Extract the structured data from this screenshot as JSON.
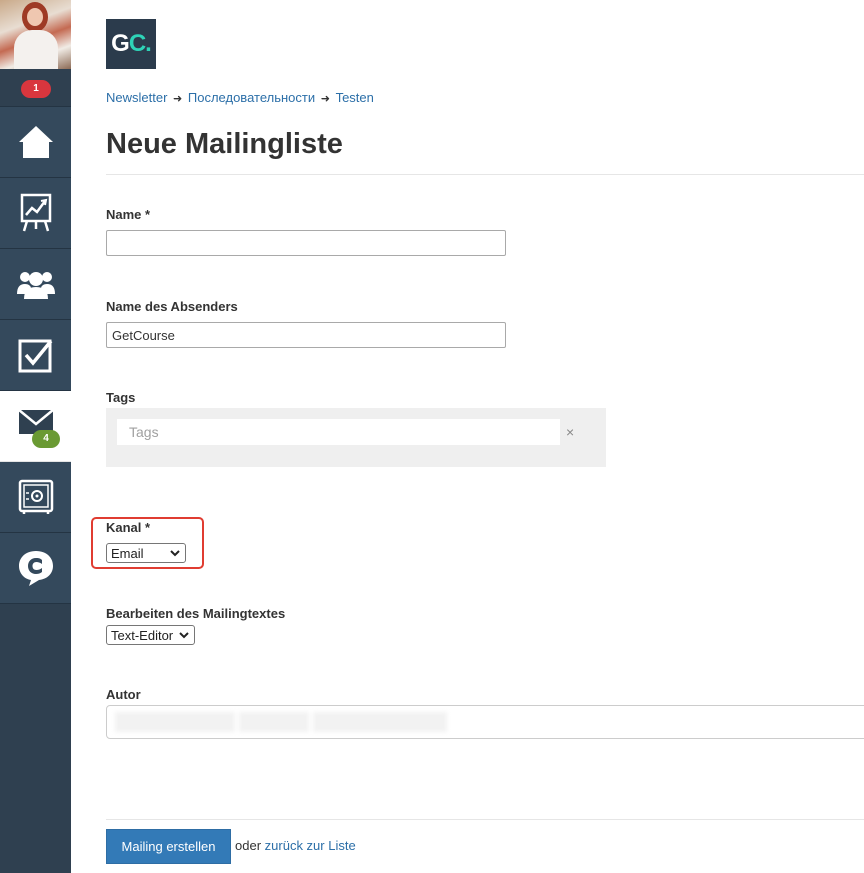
{
  "sidebar": {
    "notification_count": "1",
    "items": [
      {
        "icon": "home-icon"
      },
      {
        "icon": "chart-board-icon"
      },
      {
        "icon": "users-icon"
      },
      {
        "icon": "checkbox-icon"
      },
      {
        "icon": "mail-icon",
        "badge": "4",
        "active": true
      },
      {
        "icon": "safe-icon"
      },
      {
        "icon": "chat-logo-icon"
      }
    ]
  },
  "logo": {
    "text_main": "G",
    "text_accent": "C."
  },
  "breadcrumb": {
    "items": [
      "Newsletter",
      "Последовательности",
      "Testen"
    ],
    "separator": "➜"
  },
  "page": {
    "title": "Neue Mailingliste"
  },
  "form": {
    "name": {
      "label": "Name *",
      "value": ""
    },
    "sender": {
      "label": "Name des Absenders",
      "value": "GetCourse"
    },
    "tags": {
      "label": "Tags",
      "placeholder": "Tags",
      "clear": "×"
    },
    "channel": {
      "label": "Kanal *",
      "selected": "Email"
    },
    "editor": {
      "label": "Bearbeiten des Mailingtextes",
      "selected": "Text-Editor"
    },
    "author": {
      "label": "Autor"
    }
  },
  "footer": {
    "submit_label": "Mailing erstellen",
    "or_text": "oder",
    "back_link": "zurück zur Liste"
  },
  "colors": {
    "sidebar_bg": "#2f4050",
    "primary_button": "#337ab7",
    "link": "#2c6fa8",
    "highlight": "#e03c31",
    "badge_red": "#d9363e",
    "badge_green": "#6a9a33"
  }
}
